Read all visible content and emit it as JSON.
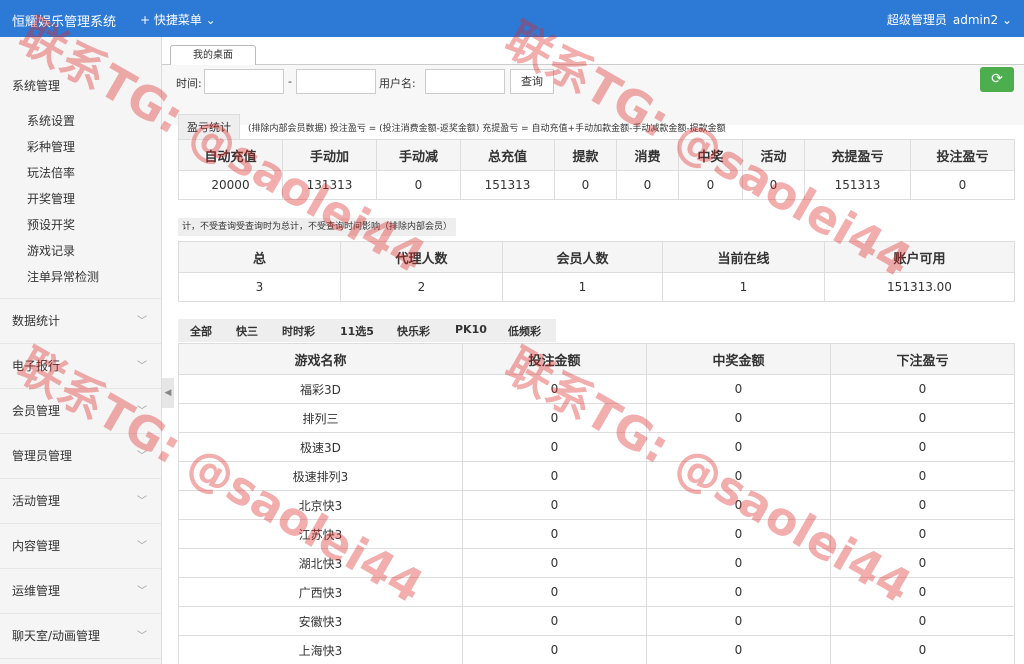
{
  "header": {
    "brand": "恒耀娱乐管理系统",
    "quick_menu": "+ 快捷菜单 ⌄",
    "role": "超级管理员",
    "username": "admin2 ⌄"
  },
  "sidebar": {
    "groups": [
      {
        "label": "系统管理",
        "items": [
          "系统设置",
          "彩种管理",
          "玩法倍率",
          "开奖管理",
          "预设开奖",
          "游戏记录",
          "注单异常检测"
        ]
      },
      {
        "label": "数据统计"
      },
      {
        "label": "电子报行"
      },
      {
        "label": "会员管理"
      },
      {
        "label": "管理员管理"
      },
      {
        "label": "活动管理"
      },
      {
        "label": "内容管理"
      },
      {
        "label": "运维管理"
      },
      {
        "label": "聊天室/动画管理"
      }
    ]
  },
  "tab": {
    "label": "我的桌面"
  },
  "filter": {
    "time_label": "时间:",
    "dash": "-",
    "username_label": "用户名:",
    "search_button": "查询"
  },
  "profit_section": {
    "label": "盈亏统计",
    "note": "(排除内部会员数据)  投注盈亏 = (投注消费金额-返奖金额)     充提盈亏 = 自动充值+手动加款金额-手动减款金额-提款金额",
    "headers": [
      "自动充值",
      "手动加",
      "手动减",
      "总充值",
      "提款",
      "消费",
      "中奖",
      "活动",
      "充提盈亏",
      "投注盈亏"
    ],
    "row": [
      "20000",
      "131313",
      "0",
      "151313",
      "0",
      "0",
      "0",
      "0",
      "151313",
      "0"
    ]
  },
  "member_section": {
    "note": "计，不受查询受查询时为总计，不受查询时间影响（排除内部会员）",
    "headers": [
      "总",
      "代理人数",
      "会员人数",
      "当前在线",
      "账户可用"
    ],
    "row": [
      "3",
      "2",
      "1",
      "1",
      "151313.00"
    ]
  },
  "lottery_tabs": [
    "全部",
    "快三",
    "时时彩",
    "11选5",
    "快乐彩",
    "PK10",
    "低频彩"
  ],
  "game_table": {
    "headers": [
      "游戏名称",
      "投注金额",
      "中奖金额",
      "下注盈亏"
    ],
    "rows": [
      [
        "福彩3D",
        "0",
        "0",
        "0"
      ],
      [
        "排列三",
        "0",
        "0",
        "0"
      ],
      [
        "极速3D",
        "0",
        "0",
        "0"
      ],
      [
        "极速排列3",
        "0",
        "0",
        "0"
      ],
      [
        "北京快3",
        "0",
        "0",
        "0"
      ],
      [
        "江苏快3",
        "0",
        "0",
        "0"
      ],
      [
        "湖北快3",
        "0",
        "0",
        "0"
      ],
      [
        "广西快3",
        "0",
        "0",
        "0"
      ],
      [
        "安徽快3",
        "0",
        "0",
        "0"
      ],
      [
        "上海快3",
        "0",
        "0",
        "0"
      ]
    ]
  },
  "watermark": "联系TG: @saolei44"
}
